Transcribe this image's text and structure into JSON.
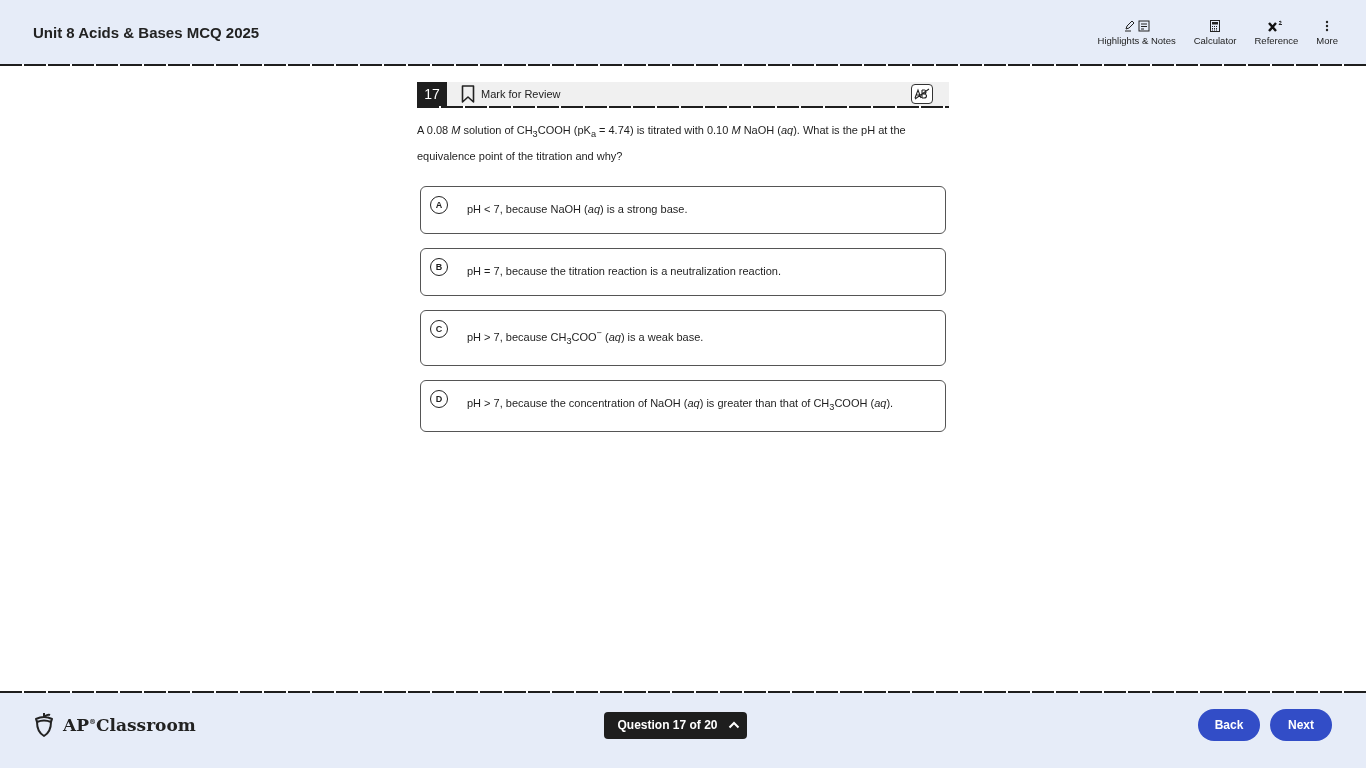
{
  "header": {
    "title": "Unit 8 Acids & Bases MCQ 2025",
    "tools": [
      {
        "kind": "highlights",
        "label": "Highlights & Notes"
      },
      {
        "kind": "calculator",
        "label": "Calculator"
      },
      {
        "kind": "reference",
        "label": "Reference"
      },
      {
        "kind": "more",
        "label": "More"
      }
    ]
  },
  "question": {
    "number": "17",
    "mark_for_review": {
      "label": "Mark for Review",
      "checked": false
    },
    "stem": "A 0.08 *M* solution of CH$_{3}$COOH (pK$_{a}$ = 4.74) is titrated with 0.10 *M* NaOH (*aq*). What is the pH at the equivalence point of the titration and why?",
    "choices": [
      {
        "letter": "A",
        "text": "pH < 7, because NaOH (*aq*) is a strong base.",
        "selected": false
      },
      {
        "letter": "B",
        "text": "pH = 7, because the titration reaction is a neutralization reaction.",
        "selected": false
      },
      {
        "letter": "C",
        "text": "pH > 7, because CH$_{3}$COO$^{−}$ (*aq*) is a weak base.",
        "selected": false
      },
      {
        "letter": "D",
        "text": "pH > 7, because the concentration of NaOH (*aq*) is greater than that of CH$_{3}$COOH (*aq*).",
        "selected": false
      }
    ]
  },
  "footer": {
    "brand": "AP",
    "brand_mark": "®",
    "brand_name": "Classroom",
    "navigator": "Question 17 of 20",
    "buttons": [
      "Back",
      "Next"
    ]
  }
}
